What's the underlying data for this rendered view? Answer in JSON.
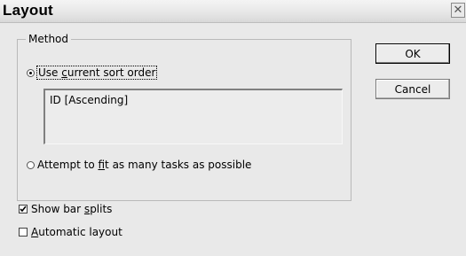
{
  "window": {
    "title": "Layout",
    "close_glyph": "✕"
  },
  "method_group": {
    "legend": "Method",
    "option_current_sort": {
      "pre": "Use ",
      "accel": "c",
      "post": "urrent sort order",
      "selected": true
    },
    "sort_list_items": [
      "ID [Ascending]"
    ],
    "option_fit_tasks": {
      "pre": "Attempt to ",
      "accel": "f",
      "post": "it as many tasks as possible",
      "selected": false
    }
  },
  "buttons": {
    "ok_label": "OK",
    "cancel_label": "Cancel"
  },
  "checkboxes": {
    "show_bar_splits": {
      "pre": "Show bar ",
      "accel": "s",
      "post": "plits",
      "checked": true
    },
    "automatic_layout": {
      "pre": "",
      "accel": "A",
      "post": "utomatic layout",
      "checked": false
    }
  },
  "icons": {
    "close": "close-icon",
    "radio": "radio-icon",
    "checkbox": "checkbox-icon"
  }
}
